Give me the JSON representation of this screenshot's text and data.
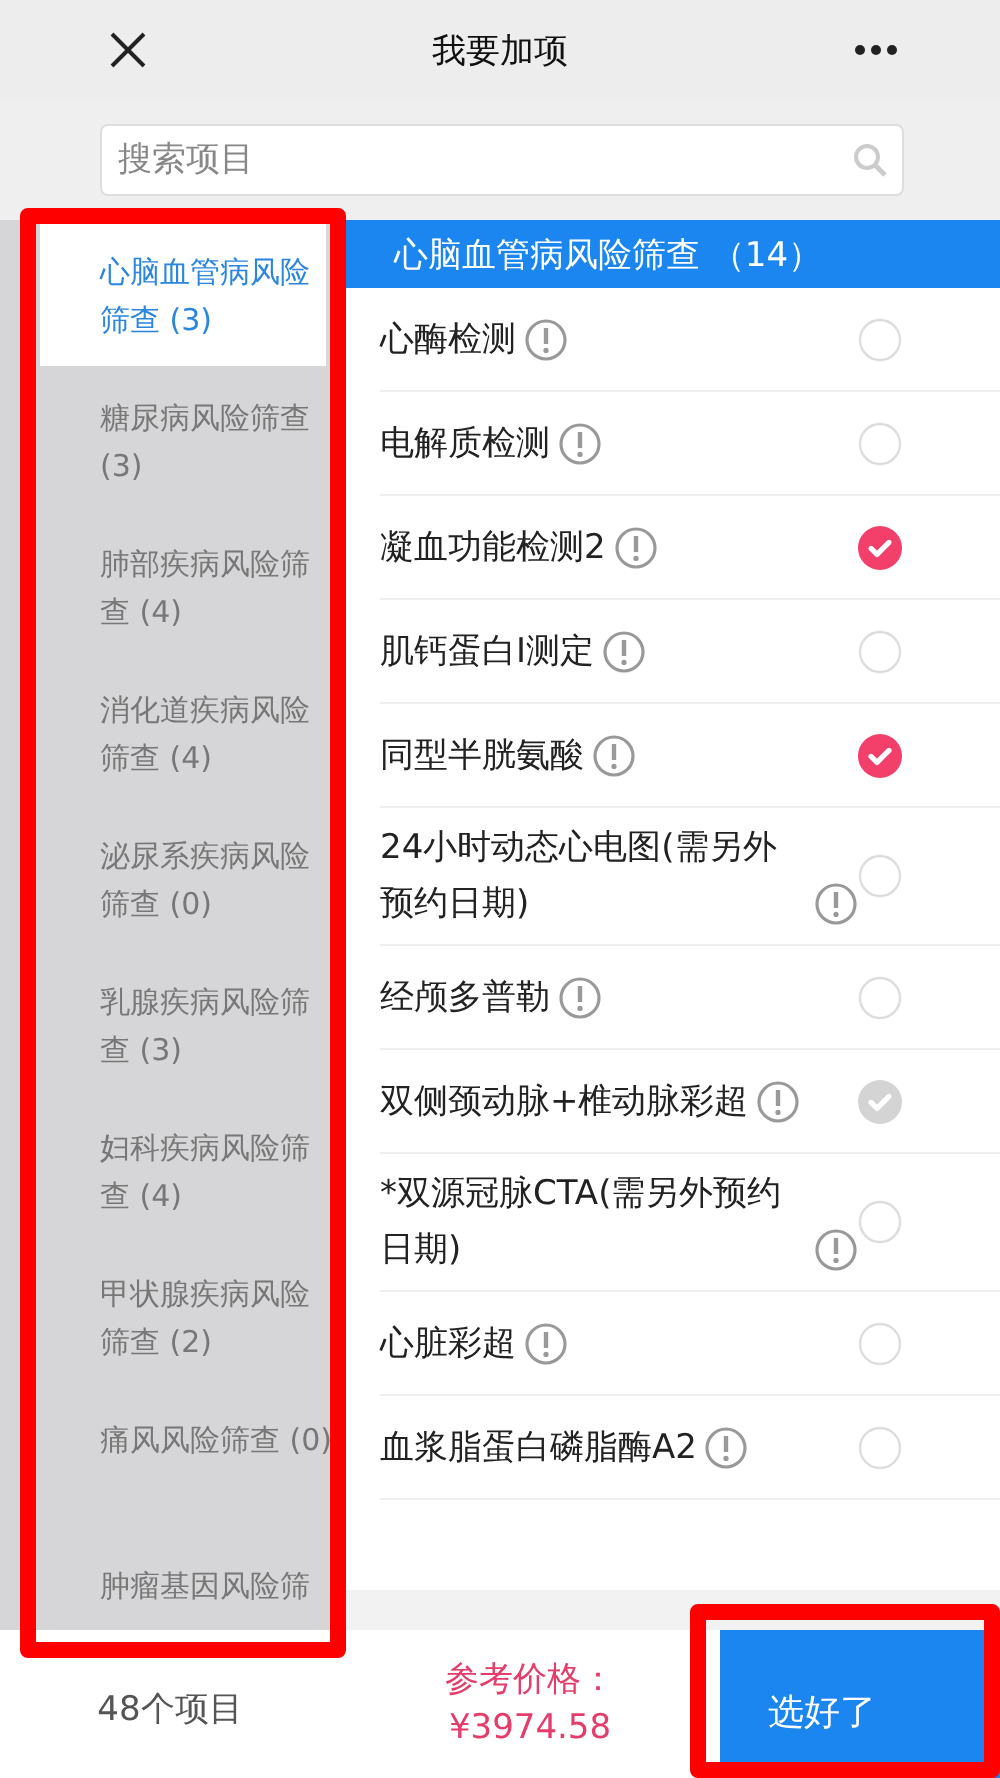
{
  "header": {
    "title": "我要加项"
  },
  "search": {
    "placeholder": "搜索项目"
  },
  "categories": [
    {
      "label": "心脑血管病风险筛查 (3)",
      "selected": true
    },
    {
      "label": "糖尿病风险筛查 (3)",
      "selected": false
    },
    {
      "label": "肺部疾病风险筛查 (4)",
      "selected": false
    },
    {
      "label": "消化道疾病风险筛查 (4)",
      "selected": false
    },
    {
      "label": "泌尿系疾病风险筛查 (0)",
      "selected": false
    },
    {
      "label": "乳腺疾病风险筛查 (3)",
      "selected": false
    },
    {
      "label": "妇科疾病风险筛查 (4)",
      "selected": false
    },
    {
      "label": "甲状腺疾病风险筛查 (2)",
      "selected": false
    },
    {
      "label": "痛风风险筛查 (0)",
      "selected": false
    },
    {
      "label": "肿瘤基因风险筛",
      "selected": false
    }
  ],
  "section": {
    "title": "心脑血管病风险筛查 （14）"
  },
  "items": [
    {
      "name": "心酶检测",
      "checked": false,
      "disabled": false
    },
    {
      "name": "电解质检测",
      "checked": false,
      "disabled": false
    },
    {
      "name": "凝血功能检测2",
      "checked": true,
      "disabled": false
    },
    {
      "name": "肌钙蛋白I测定",
      "checked": false,
      "disabled": false
    },
    {
      "name": "同型半胱氨酸",
      "checked": true,
      "disabled": false
    },
    {
      "name": "24小时动态心电图(需另外预约日期)",
      "checked": false,
      "disabled": false
    },
    {
      "name": "经颅多普勒",
      "checked": false,
      "disabled": false
    },
    {
      "name": "双侧颈动脉+椎动脉彩超",
      "checked": true,
      "disabled": true
    },
    {
      "name": "*双源冠脉CTA(需另外预约日期)",
      "checked": false,
      "disabled": false
    },
    {
      "name": "心脏彩超",
      "checked": false,
      "disabled": false
    },
    {
      "name": "血浆脂蛋白磷脂酶A2",
      "checked": false,
      "disabled": false
    }
  ],
  "footer": {
    "count": "48个项目",
    "price_label": "参考价格：",
    "price": "¥3974.58",
    "confirm": "选好了"
  }
}
